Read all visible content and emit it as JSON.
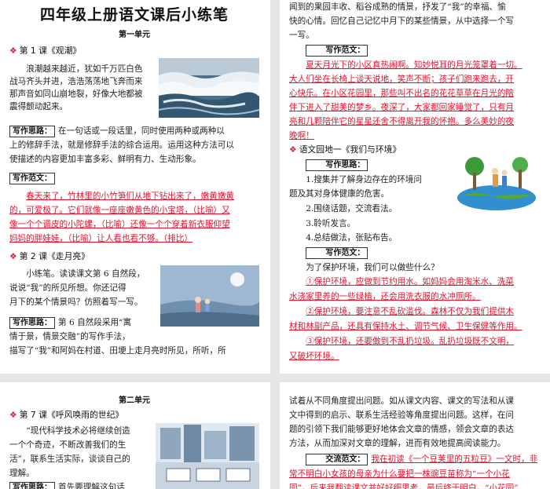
{
  "page1": {
    "title": "四年级上册语文课后小练笔",
    "unit": "第一单元",
    "lesson1": {
      "heading": "第 1 课《观潮》",
      "body": [
        "浪潮越来越近，犹如千万匹白色",
        "战马齐头并进，浩浩荡荡地飞奔而来",
        "那声音如同山崩地裂，好像大地都被",
        "震得颤动起来。"
      ],
      "thinking_label": "写作思路：",
      "thinking": [
        "在一句话或一段话里，同时使用两种或两种以",
        "上的修辞手法，就是修辞手法的综合运用。运用这种方法可以",
        "使描述的内容更加丰富多彩、鲜明有力、生动形象。"
      ],
      "sample_label": "写作范文：",
      "sample": [
        "春天来了，竹林里的小竹笋们从地下钻出来了，嫩黄嫩黄",
        "的，可爱极了。它们就像一座座嫩黄色的小宝塔，（比喻）又",
        "像一个个调皮的小陀螺，（比喻）还像一个个穿着新衣服仰望",
        "妈妈的胖娃娃，（比喻）让人看也看不够。（排比）"
      ]
    },
    "lesson2": {
      "heading": "第 2 课《走月亮》",
      "body": [
        "小练笔。读读课文第 6 自然段，",
        "说说“我”的所见所想。你还记得",
        "月下的某个情景吗？仿照着写一写。"
      ],
      "thinking_label": "写作思路：",
      "thinking": [
        "第 6 自然段采用“寓",
        "情于景，情景交融”的写作手法，",
        "描写了“我”和阿妈在村道、田埂上走月亮时所见，所听，所"
      ]
    }
  },
  "page2": {
    "intro": [
      "闻到的果园丰收、稻谷成熟的情景，抒发了“我”的幸福、愉",
      "快的心情。回忆自己记忆中月下的某些情景，从中选择一个写",
      "一写。"
    ],
    "sample_label": "写作范文：",
    "sample": [
      "夏天月光下的小区真热闹啊。知妙悦耳的月光笼罩着一切。",
      "大人们坐在长椅上谈天说地，笑声不断；孩子们跑来跑去，开",
      "心快乐。在小区花园里，那些叫不出名的花花草草在月光的陪",
      "伴下进入了甜美的梦乡。夜深了，大家都回家睡觉了，只有月",
      "亮和几颗陪伴它的星星还舍不得离开我的怀抱。多么美妙的夜",
      "晚啊！"
    ],
    "garden": {
      "heading": "语文园地一《我们与环境》",
      "thinking_label": "写作思路：",
      "steps": [
        "1.搜集并了解身边存在的环境问",
        "题及其对身体健康的危害。",
        "2.围绕话题，交流看法。",
        "3.聆听发言。",
        "4.总结做法，张贴布告。"
      ],
      "sample_label": "写作范文：",
      "question": "为了保护环境，我们可以做些什么？",
      "answers": [
        "①保护环境，应做到节约用水。如妈妈会用淘米水、洗菜",
        "水浇家里养的一些绿植，还会用洗衣服的水冲厕所。",
        "②保护环境，要注意不乱砍滥伐。森林不仅为我们提供木",
        "材和林副产品，还具有保持水土、调节气候、卫生保健等作用。",
        "③保护环境，还要做到不乱扔垃圾。乱扔垃圾既不文明，",
        "又破坏环境。"
      ]
    }
  },
  "page3": {
    "unit": "第二单元",
    "heading": "第 7 课《呼风唤雨的世纪》",
    "body": [
      "“现代科学技术必将继续创造",
      "一个个奇迹，不断改善我们的生",
      "活”，联系生活实际，谈谈自己的",
      "理解。"
    ],
    "thinking_label": "写作思路：",
    "thinking_tail": "首先要理解这句话"
  },
  "page4": {
    "body": [
      "试着从不同角度提出问题。如从课文内容、课文的写法和从课",
      "文中得到的启示、联系生活经验等角度提出问题。这样，在问",
      "题的引领下我们能够更好地体会文章的情感，领会文章的表达",
      "方法，从而加深对文章的理解，进而有效地提高阅读能力。"
    ],
    "exchange_label": "交流范文：",
    "sample": [
      "我在初读《一个豆荚里的五粒豆》一文时，非",
      "常不明白小女孩的母亲为什么要把一株豌豆苗称为“一个小花",
      "园”，后来我翻读课文并好好细思考，最后终于明白，“小花园”"
    ]
  },
  "colors": {
    "accent_red": "#e8112d",
    "diamond": "#d0203a"
  },
  "icons": [
    "diamond-bullet-icon",
    "ocean-tide-illustration",
    "moonlit-walk-illustration",
    "earth-environment-illustration",
    "future-technology-illustration"
  ]
}
